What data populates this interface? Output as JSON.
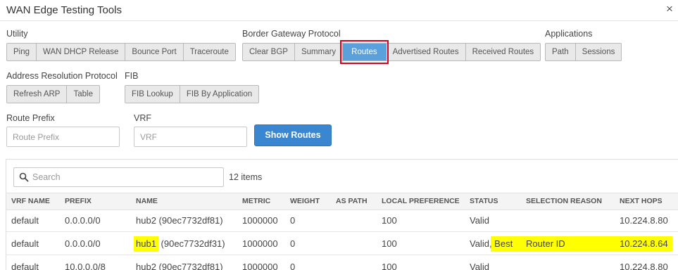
{
  "window": {
    "title": "WAN Edge Testing Tools",
    "close_glyph": "×"
  },
  "groups": {
    "utility": {
      "label": "Utility",
      "buttons": [
        "Ping",
        "WAN DHCP Release",
        "Bounce Port",
        "Traceroute"
      ]
    },
    "bgp": {
      "label": "Border Gateway Protocol",
      "buttons": [
        "Clear BGP",
        "Summary",
        "Routes",
        "Advertised Routes",
        "Received Routes"
      ],
      "active": "Routes"
    },
    "applications": {
      "label": "Applications",
      "buttons": [
        "Path",
        "Sessions"
      ]
    },
    "arp": {
      "label": "Address Resolution Protocol",
      "buttons": [
        "Refresh ARP",
        "Table"
      ]
    },
    "fib": {
      "label": "FIB",
      "buttons": [
        "FIB Lookup",
        "FIB By Application"
      ]
    }
  },
  "form": {
    "route_prefix_label": "Route Prefix",
    "route_prefix_placeholder": "Route Prefix",
    "route_prefix_value": "",
    "vrf_label": "VRF",
    "vrf_placeholder": "VRF",
    "vrf_value": "",
    "submit_label": "Show Routes"
  },
  "results": {
    "search_placeholder": "Search",
    "search_value": "",
    "item_count": "12 items",
    "columns": [
      "VRF NAME",
      "PREFIX",
      "NAME",
      "METRIC",
      "WEIGHT",
      "AS PATH",
      "LOCAL PREFERENCE",
      "STATUS",
      "SELECTION REASON",
      "NEXT HOPS"
    ],
    "rows": [
      {
        "vrf": "default",
        "prefix": "0.0.0.0/0",
        "name_host": "hub2",
        "name_id": " (90ec7732df81)",
        "metric": "1000000",
        "weight": "0",
        "as_path": "",
        "local_pref": "100",
        "status_a": "Valid",
        "status_b": "",
        "reason": "",
        "next_hops": "10.224.8.80"
      },
      {
        "vrf": "default",
        "prefix": "0.0.0.0/0",
        "name_host": "hub1",
        "name_id": " (90ec7732df31)",
        "metric": "1000000",
        "weight": "0",
        "as_path": "",
        "local_pref": "100",
        "status_a": "Valid",
        "status_b": ", Best",
        "reason": "Router ID",
        "next_hops": "10.224.8.64"
      },
      {
        "vrf": "default",
        "prefix": "10.0.0.0/8",
        "name_host": "hub2",
        "name_id": " (90ec7732df81)",
        "metric": "1000000",
        "weight": "0",
        "as_path": "",
        "local_pref": "100",
        "status_a": "Valid",
        "status_b": "",
        "reason": "",
        "next_hops": "10.224.8.80"
      }
    ]
  },
  "colors": {
    "active_button": "#5aa0dc",
    "primary_button": "#3b86d1",
    "highlight": "#ffff00",
    "annotation_box": "#d6001c"
  }
}
